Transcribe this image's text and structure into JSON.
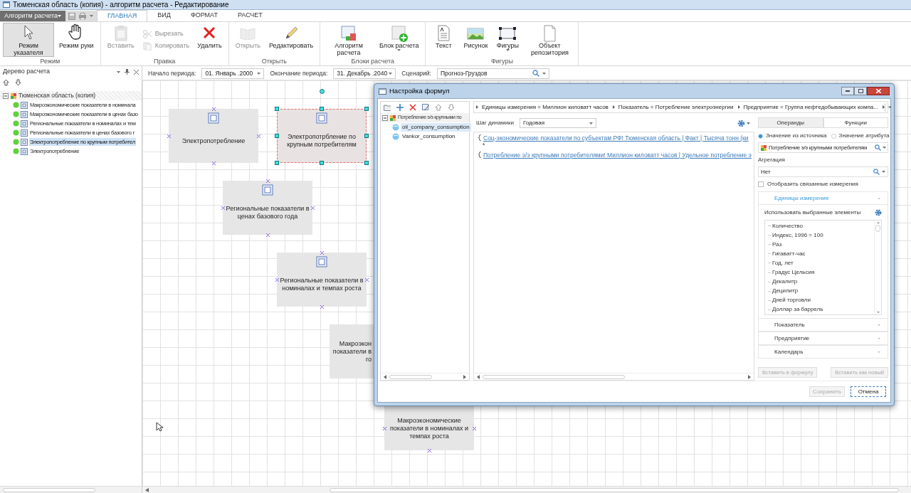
{
  "window": {
    "title": "Тюменская область (копия) - алгоритм расчета - Редактирование"
  },
  "app_menu": "Алгоритм расчета",
  "ribbon_tabs": [
    {
      "label": "ГЛАВНАЯ",
      "selected": true
    },
    {
      "label": "ВИД",
      "selected": false
    },
    {
      "label": "ФОРМАТ",
      "selected": false
    },
    {
      "label": "РАСЧЕТ",
      "selected": false
    }
  ],
  "ribbon_groups": [
    {
      "label": "Режим",
      "buttons": [
        {
          "kind": "large",
          "label": "Режим указателя",
          "selected": true,
          "disabled": false
        },
        {
          "kind": "large",
          "label": "Режим руки",
          "selected": false,
          "disabled": false
        }
      ]
    },
    {
      "label": "Правка",
      "buttons": [
        {
          "kind": "large",
          "label": "Вставить",
          "selected": false,
          "disabled": true
        },
        {
          "kind": "small",
          "label": "Вырезать",
          "selected": false,
          "disabled": true
        },
        {
          "kind": "small",
          "label": "Копировать",
          "selected": false,
          "disabled": true
        },
        {
          "kind": "large",
          "label": "Удалить",
          "selected": false,
          "disabled": false
        }
      ]
    },
    {
      "label": "Открыть",
      "buttons": [
        {
          "kind": "large",
          "label": "Открыть",
          "selected": false,
          "disabled": true
        },
        {
          "kind": "large",
          "label": "Редактировать",
          "selected": false,
          "disabled": false
        }
      ]
    },
    {
      "label": "Блоки расчета",
      "buttons": [
        {
          "kind": "large",
          "label": "Алгоритм расчета",
          "selected": false,
          "disabled": false
        },
        {
          "kind": "large",
          "label": "Блок расчета",
          "selected": false,
          "disabled": false
        }
      ]
    },
    {
      "label": "Фигуры",
      "buttons": [
        {
          "kind": "large",
          "label": "Текст",
          "selected": false,
          "disabled": false
        },
        {
          "kind": "large",
          "label": "Рисунок",
          "selected": false,
          "disabled": false
        },
        {
          "kind": "large",
          "label": "Фигуры",
          "selected": false,
          "disabled": false
        },
        {
          "kind": "large",
          "label": "Объект репозитория",
          "selected": false,
          "disabled": false
        }
      ]
    }
  ],
  "tree_panel": {
    "title": "Дерево расчета",
    "root": "Тюменская область (копия)",
    "items": [
      {
        "label": "Макроэкономические показатели в номинала",
        "selected": false
      },
      {
        "label": "Макроэкономические показатели в ценах базо",
        "selected": false
      },
      {
        "label": "Региональные показатели в номиналах и тем",
        "selected": false
      },
      {
        "label": "Региональные показатели в ценах базового г",
        "selected": false
      },
      {
        "label": "Электропотребление по крупным потребител",
        "selected": true
      },
      {
        "label": "Электропотребление",
        "selected": false
      }
    ]
  },
  "toolbar": {
    "fields": [
      {
        "label": "Начало периода:",
        "value": "01. Январь .2000",
        "kind": "date"
      },
      {
        "label": "Окончание периода:",
        "value": "31. Декабрь .2040",
        "kind": "date"
      },
      {
        "label": "Сценарий:",
        "value": "Прогноз-Груздов",
        "kind": "search"
      }
    ]
  },
  "canvas_nodes": [
    {
      "lines": [
        "Электропотребление"
      ],
      "selected": false
    },
    {
      "lines": [
        "Электропотрбление по",
        "крупным потребителям"
      ],
      "selected": true
    },
    {
      "lines": [
        "Региональные показатели в",
        "ценах базового года"
      ],
      "selected": false
    },
    {
      "lines": [
        "Региональные показатели в",
        "номиналах и темпах роста"
      ],
      "selected": false
    },
    {
      "lines": [
        "Макроэкон",
        "показатели в",
        "го"
      ],
      "selected": false
    },
    {
      "lines": [
        "Макроэкономические",
        "показатели в номиналах и",
        "темпах роста"
      ],
      "selected": false
    }
  ],
  "dialog": {
    "title": "Настройка формул",
    "tree": {
      "root": "Потребление э/э крупными по",
      "items": [
        {
          "label": "oil_company_consumption",
          "selected": true
        },
        {
          "label": "Vankor_consumption",
          "selected": false
        }
      ]
    },
    "breadcrumbs": [
      "Единицы измерения = Миллион киловатт часов",
      "Показатель = Потребление электроэнергии",
      "Предприятие = Группа нефтедобывающих компа..."
    ],
    "breadcrumb_more": "»",
    "step_label": "Шаг динамики",
    "step_value": "Годовая",
    "formula": [
      {
        "kind": "link",
        "text": "Соц-экономические показатели по субъектам РФ! Тюменская область | Факт | Тысяча тонн (ки"
      },
      {
        "kind": "op",
        "text": "*"
      },
      {
        "kind": "link",
        "text": "Потребление э/э крупными потребителями! Миллион киловатт часов | Удельное потребление э"
      }
    ],
    "side_tabs": [
      {
        "label": "Операнды",
        "selected": true
      },
      {
        "label": "Функции",
        "selected": false
      }
    ],
    "radios": [
      {
        "label": "Значение из источника",
        "selected": true
      },
      {
        "label": "Значение атрибута",
        "selected": false
      }
    ],
    "source": "Потребление э/э крупными потребителям",
    "aggregation_label": "Агрегация",
    "aggregation": "Нет",
    "show_linked": {
      "label": "Отобразить связанные измерения",
      "checked": false
    },
    "sections": [
      {
        "label": "Единицы измерения",
        "expanded": true,
        "option": "Использовать выбранные элементы",
        "items": [
          "Количество",
          "Индекс, 1996 = 100",
          "Раз",
          "Гигаватт-час",
          "Год, лет",
          "Градус Цельсия",
          "Декалитр",
          "Децилитр",
          "Дней торговли",
          "Доллар за баррель"
        ]
      },
      {
        "label": "Показатель",
        "expanded": false
      },
      {
        "label": "Предприятие",
        "expanded": false
      },
      {
        "label": "Календарь",
        "expanded": false
      }
    ],
    "insert_buttons": [
      {
        "label": "Вставить в формулу",
        "disabled": true
      },
      {
        "label": "Вставить как новый",
        "disabled": true
      }
    ],
    "buttons": [
      {
        "label": "Сохранить",
        "disabled": true
      },
      {
        "label": "Отмена",
        "disabled": false
      }
    ]
  }
}
